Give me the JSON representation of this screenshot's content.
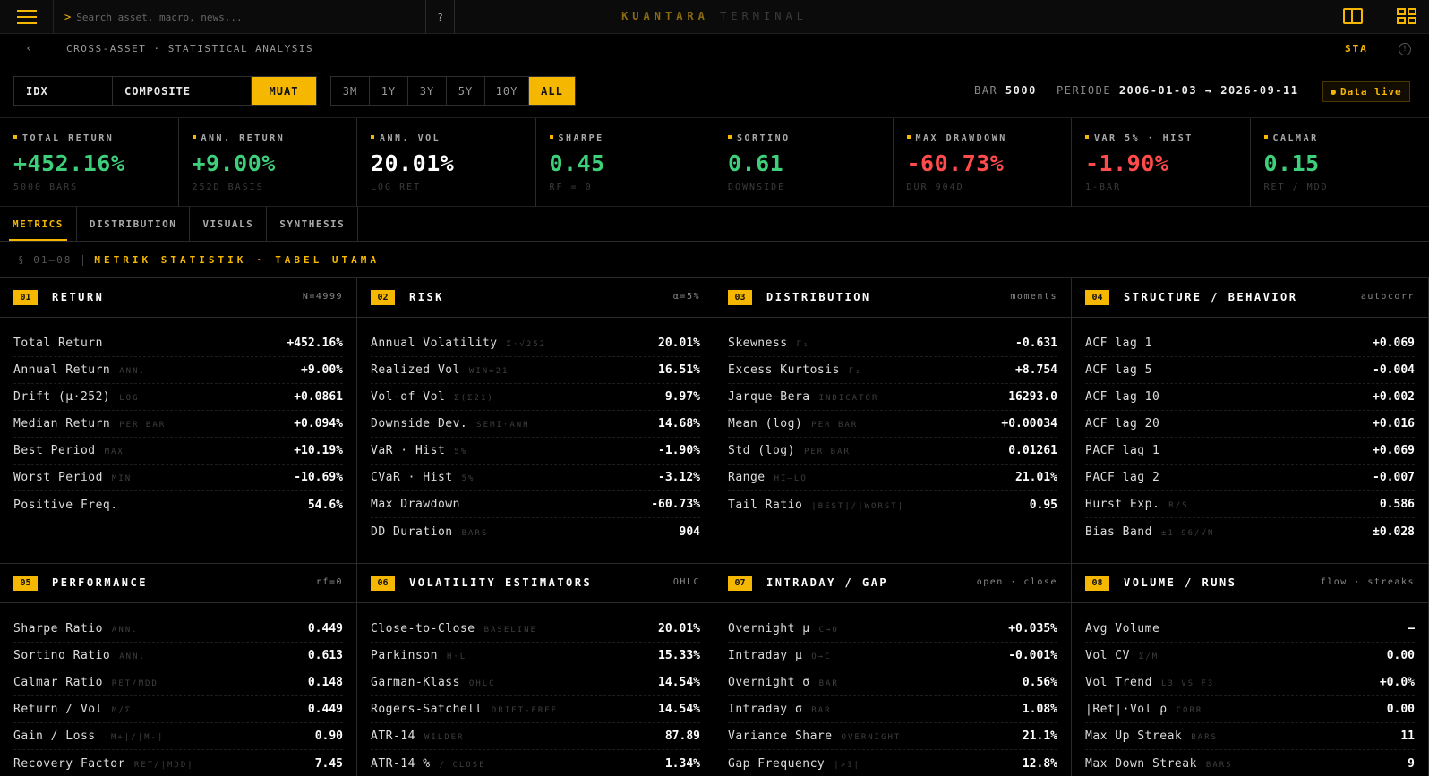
{
  "topbar": {
    "search_prompt": ">",
    "search_placeholder": "Search asset, macro, news...",
    "help_label": "?",
    "brand_primary": "KUANTARA",
    "brand_secondary": "TERMINAL"
  },
  "breadcrumb": {
    "back": "‹",
    "path": "CROSS-ASSET · STATISTICAL ANALYSIS",
    "code": "STA",
    "info": "!"
  },
  "controls": {
    "idx": "IDX",
    "composite": "COMPOSITE",
    "load": "MUAT",
    "ranges": [
      "3M",
      "1Y",
      "3Y",
      "5Y",
      "10Y",
      "ALL"
    ],
    "active_range": "ALL",
    "bar_label": "BAR",
    "bar_value": "5000",
    "period_label": "PERIODE",
    "period_value": "2006-01-03 → 2026-09-11",
    "live_label": "Data live"
  },
  "kpis": [
    {
      "label": "TOTAL RETURN",
      "value": "+452.16%",
      "sub": "5000 BARS",
      "tone": "pos"
    },
    {
      "label": "ANN. RETURN",
      "value": "+9.00%",
      "sub": "252D BASIS",
      "tone": "pos"
    },
    {
      "label": "ANN. VOL",
      "value": "20.01%",
      "sub": "LOG RET",
      "tone": "neu"
    },
    {
      "label": "SHARPE",
      "value": "0.45",
      "sub": "RF = 0",
      "tone": "pos"
    },
    {
      "label": "SORTINO",
      "value": "0.61",
      "sub": "DOWNSIDE",
      "tone": "pos"
    },
    {
      "label": "MAX DRAWDOWN",
      "value": "-60.73%",
      "sub": "DUR 904D",
      "tone": "neg"
    },
    {
      "label": "VAR 5% · HIST",
      "value": "-1.90%",
      "sub": "1-BAR",
      "tone": "neg"
    },
    {
      "label": "CALMAR",
      "value": "0.15",
      "sub": "RET / MDD",
      "tone": "pos"
    }
  ],
  "tabs": [
    "METRICS",
    "DISTRIBUTION",
    "VISUALS",
    "SYNTHESIS"
  ],
  "section": {
    "num": "§ 01–08",
    "title": "METRIK STATISTIK · TABEL UTAMA"
  },
  "panels": [
    {
      "num": "01",
      "title": "RETURN",
      "tag": "N=4999",
      "rows": [
        {
          "k": "Total Return",
          "h": "",
          "v": "+452.16%"
        },
        {
          "k": "Annual Return",
          "h": "ANN.",
          "v": "+9.00%"
        },
        {
          "k": "Drift (μ·252)",
          "h": "LOG",
          "v": "+0.0861"
        },
        {
          "k": "Median Return",
          "h": "PER BAR",
          "v": "+0.094%"
        },
        {
          "k": "Best Period",
          "h": "MAX",
          "v": "+10.19%"
        },
        {
          "k": "Worst Period",
          "h": "MIN",
          "v": "-10.69%"
        },
        {
          "k": "Positive Freq.",
          "h": "",
          "v": "54.6%"
        }
      ]
    },
    {
      "num": "02",
      "title": "RISK",
      "tag": "α=5%",
      "rows": [
        {
          "k": "Annual Volatility",
          "h": "Σ·√252",
          "v": "20.01%"
        },
        {
          "k": "Realized Vol",
          "h": "WIN=21",
          "v": "16.51%"
        },
        {
          "k": "Vol-of-Vol",
          "h": "Σ(Σ21)",
          "v": "9.97%"
        },
        {
          "k": "Downside Dev.",
          "h": "SEMI·ANN",
          "v": "14.68%"
        },
        {
          "k": "VaR · Hist",
          "h": "5%",
          "v": "-1.90%"
        },
        {
          "k": "CVaR · Hist",
          "h": "5%",
          "v": "-3.12%"
        },
        {
          "k": "Max Drawdown",
          "h": "",
          "v": "-60.73%"
        },
        {
          "k": "DD Duration",
          "h": "BARS",
          "v": "904"
        }
      ]
    },
    {
      "num": "03",
      "title": "DISTRIBUTION",
      "tag": "moments",
      "rows": [
        {
          "k": "Skewness",
          "h": "Γ₁",
          "v": "-0.631"
        },
        {
          "k": "Excess Kurtosis",
          "h": "Γ₂",
          "v": "+8.754"
        },
        {
          "k": "Jarque-Bera",
          "h": "INDICATOR",
          "v": "16293.0"
        },
        {
          "k": "Mean (log)",
          "h": "PER BAR",
          "v": "+0.00034"
        },
        {
          "k": "Std (log)",
          "h": "PER BAR",
          "v": "0.01261"
        },
        {
          "k": "Range",
          "h": "HI–LO",
          "v": "21.01%"
        },
        {
          "k": "Tail Ratio",
          "h": "|BEST|/|WORST|",
          "v": "0.95"
        }
      ]
    },
    {
      "num": "04",
      "title": "STRUCTURE / BEHAVIOR",
      "tag": "autocorr",
      "rows": [
        {
          "k": "ACF lag 1",
          "h": "",
          "v": "+0.069"
        },
        {
          "k": "ACF lag 5",
          "h": "",
          "v": "-0.004"
        },
        {
          "k": "ACF lag 10",
          "h": "",
          "v": "+0.002"
        },
        {
          "k": "ACF lag 20",
          "h": "",
          "v": "+0.016"
        },
        {
          "k": "PACF lag 1",
          "h": "",
          "v": "+0.069"
        },
        {
          "k": "PACF lag 2",
          "h": "",
          "v": "-0.007"
        },
        {
          "k": "Hurst Exp.",
          "h": "R/S",
          "v": "0.586"
        },
        {
          "k": "Bias Band",
          "h": "±1.96/√N",
          "v": "±0.028"
        }
      ]
    },
    {
      "num": "05",
      "title": "PERFORMANCE",
      "tag": "rf=0",
      "rows": [
        {
          "k": "Sharpe Ratio",
          "h": "ANN.",
          "v": "0.449"
        },
        {
          "k": "Sortino Ratio",
          "h": "ANN.",
          "v": "0.613"
        },
        {
          "k": "Calmar Ratio",
          "h": "RET/MDD",
          "v": "0.148"
        },
        {
          "k": "Return / Vol",
          "h": "M/Σ",
          "v": "0.449"
        },
        {
          "k": "Gain / Loss",
          "h": "|M+|/|M-|",
          "v": "0.90"
        },
        {
          "k": "Recovery Factor",
          "h": "RET/|MDD|",
          "v": "7.45"
        }
      ]
    },
    {
      "num": "06",
      "title": "VOLATILITY ESTIMATORS",
      "tag": "OHLC",
      "rows": [
        {
          "k": "Close-to-Close",
          "h": "BASELINE",
          "v": "20.01%"
        },
        {
          "k": "Parkinson",
          "h": "H·L",
          "v": "15.33%"
        },
        {
          "k": "Garman-Klass",
          "h": "OHLC",
          "v": "14.54%"
        },
        {
          "k": "Rogers-Satchell",
          "h": "DRIFT-FREE",
          "v": "14.54%"
        },
        {
          "k": "ATR-14",
          "h": "WILDER",
          "v": "87.89"
        },
        {
          "k": "ATR-14 %",
          "h": "/ CLOSE",
          "v": "1.34%"
        }
      ]
    },
    {
      "num": "07",
      "title": "INTRADAY / GAP",
      "tag": "open · close",
      "rows": [
        {
          "k": "Overnight μ",
          "h": "C→O",
          "v": "+0.035%"
        },
        {
          "k": "Intraday μ",
          "h": "O→C",
          "v": "-0.001%"
        },
        {
          "k": "Overnight σ",
          "h": "BAR",
          "v": "0.56%"
        },
        {
          "k": "Intraday σ",
          "h": "BAR",
          "v": "1.08%"
        },
        {
          "k": "Variance Share",
          "h": "OVERNIGHT",
          "v": "21.1%"
        },
        {
          "k": "Gap Frequency",
          "h": "|>1|",
          "v": "12.8%"
        }
      ]
    },
    {
      "num": "08",
      "title": "VOLUME / RUNS",
      "tag": "flow · streaks",
      "rows": [
        {
          "k": "Avg Volume",
          "h": "",
          "v": "—"
        },
        {
          "k": "Vol CV",
          "h": "Σ/M",
          "v": "0.00"
        },
        {
          "k": "Vol Trend",
          "h": "L3 VS F3",
          "v": "+0.0%"
        },
        {
          "k": "|Ret|·Vol ρ",
          "h": "CORR",
          "v": "0.00"
        },
        {
          "k": "Max Up Streak",
          "h": "BARS",
          "v": "11"
        },
        {
          "k": "Max Down Streak",
          "h": "BARS",
          "v": "9"
        }
      ]
    }
  ]
}
